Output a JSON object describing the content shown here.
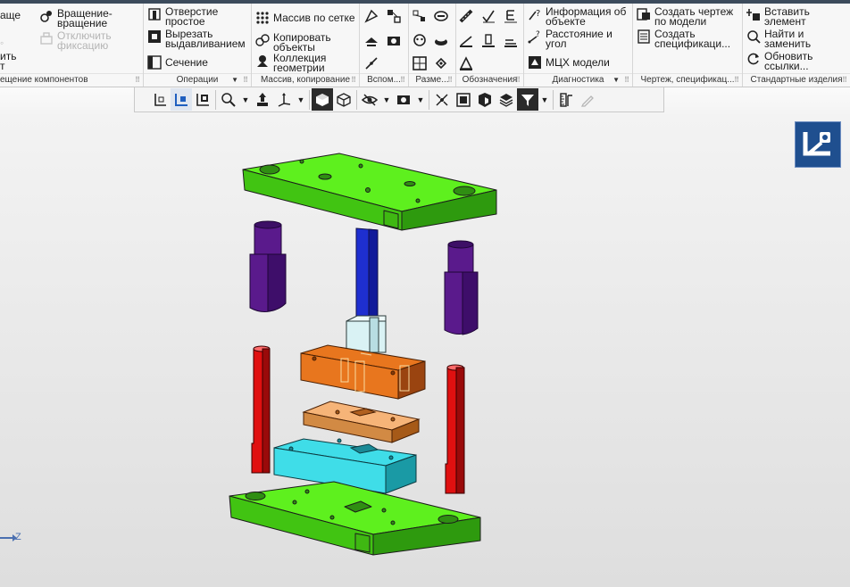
{
  "ribbon": {
    "groups": {
      "edit": {
        "footer": "ещение компонентов",
        "left_labels": [
          "аще",
          "ить",
          "т"
        ],
        "rotate": {
          "line1": "Вращение-",
          "line2": "вращение"
        },
        "unfix": {
          "line1": "Отключить",
          "line2": "фиксацию"
        }
      },
      "operations": {
        "footer": "Операции",
        "hole": {
          "line1": "Отверстие",
          "line2": "простое"
        },
        "extrude_cut": {
          "line1": "Вырезать",
          "line2": "выдавливанием"
        },
        "section": "Сечение"
      },
      "pattern": {
        "footer": "Массив, копирование",
        "grid": "Массив по сетке",
        "copy": {
          "line1": "Копировать",
          "line2": "объекты"
        },
        "collection": {
          "line1": "Коллекция",
          "line2": "геометрии"
        }
      },
      "aux": {
        "footer": "Вспом..."
      },
      "dims": {
        "footer": "Разме..."
      },
      "marks": {
        "footer": "Обозначения"
      },
      "diagnostics": {
        "footer": "Диагностика",
        "info": {
          "line1": "Информация об",
          "line2": "объекте"
        },
        "distance": {
          "line1": "Расстояние и",
          "line2": "угол"
        },
        "mch": "МЦХ модели"
      },
      "drawing": {
        "footer": "Чертеж, спецификац...",
        "create_drawing": {
          "line1": "Создать чертеж",
          "line2": "по модели"
        },
        "create_spec": {
          "line1": "Создать",
          "line2": "спецификаци..."
        }
      },
      "std": {
        "footer": "Стандартные изделия",
        "insert": {
          "line1": "Вставить",
          "line2": "элемент"
        },
        "find": {
          "line1": "Найти и",
          "line2": "заменить"
        },
        "update": {
          "line1": "Обновить",
          "line2": "ссылки..."
        }
      }
    }
  },
  "viewport": {
    "axis_label": "Z",
    "colors": {
      "plate": "#5ef01e",
      "pin": "#e01010",
      "bushing": "#5a1a8c",
      "punch": "#1e2fd0",
      "block": "#e8761e",
      "stripper": "#f6b478",
      "die": "#3fdde8",
      "bushing_small": "#d9f2f4"
    }
  }
}
